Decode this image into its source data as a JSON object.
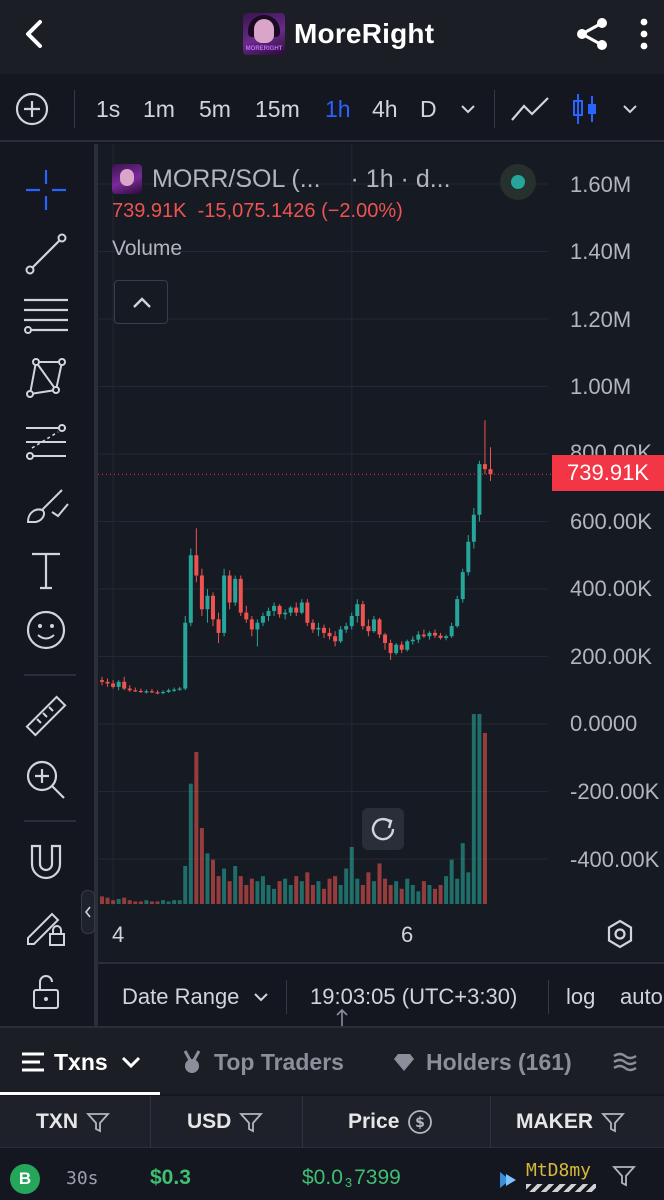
{
  "header": {
    "title": "MoreRight",
    "logo_text": "MORERIGHT"
  },
  "toolbar": {
    "intervals": [
      "1s",
      "1m",
      "5m",
      "15m",
      "1h",
      "4h",
      "D"
    ],
    "active_interval": "1h"
  },
  "legend": {
    "pair": "MORR/SOL (...",
    "timeframe": "· 1h · d...",
    "value": "739.91K",
    "change": "-15,075.1426 (−2.00%)",
    "volume_label": "Volume"
  },
  "price_axis": {
    "labels": [
      "1.60M",
      "1.40M",
      "1.20M",
      "1.00M",
      "800.00K",
      "600.00K",
      "400.00K",
      "200.00K",
      "0.0000",
      "-200.00K",
      "-400.00K"
    ],
    "last_price": "739.91K"
  },
  "time_axis": {
    "labels": [
      "4",
      "6"
    ]
  },
  "footer": {
    "date_range": "Date Range",
    "time": "19:03:05 (UTC+3:30)",
    "log": "log",
    "auto": "auto"
  },
  "tabs": {
    "txns": "Txns",
    "top_traders": "Top Traders",
    "holders": "Holders (161)"
  },
  "table": {
    "headers": [
      "TXN",
      "USD",
      "Price",
      "MAKER"
    ],
    "rows": [
      {
        "type": "B",
        "age": "30s",
        "usd": "$0.3",
        "price_prefix": "$0.0",
        "price_zeros": "3",
        "price_digits": "7399",
        "maker": "MtD8my"
      }
    ]
  },
  "colors": {
    "up": "#26a69a",
    "down": "#ef5350",
    "accent": "#2962ff",
    "last_price_tag": "#f23645"
  },
  "chart_data": {
    "type": "candlestick",
    "title": "",
    "ylim": [
      -450000,
      1700000
    ],
    "candles": [
      {
        "o": 130000,
        "h": 140000,
        "l": 115000,
        "c": 125000
      },
      {
        "o": 125000,
        "h": 135000,
        "l": 110000,
        "c": 120000
      },
      {
        "o": 120000,
        "h": 130000,
        "l": 105000,
        "c": 110000
      },
      {
        "o": 110000,
        "h": 130000,
        "l": 100000,
        "c": 125000
      },
      {
        "o": 125000,
        "h": 140000,
        "l": 100000,
        "c": 105000
      },
      {
        "o": 105000,
        "h": 115000,
        "l": 95000,
        "c": 100000
      },
      {
        "o": 100000,
        "h": 108000,
        "l": 95000,
        "c": 98000
      },
      {
        "o": 98000,
        "h": 105000,
        "l": 92000,
        "c": 95000
      },
      {
        "o": 95000,
        "h": 102000,
        "l": 90000,
        "c": 97000
      },
      {
        "o": 97000,
        "h": 104000,
        "l": 92000,
        "c": 94000
      },
      {
        "o": 94000,
        "h": 100000,
        "l": 88000,
        "c": 92000
      },
      {
        "o": 92000,
        "h": 100000,
        "l": 88000,
        "c": 95000
      },
      {
        "o": 95000,
        "h": 105000,
        "l": 92000,
        "c": 100000
      },
      {
        "o": 100000,
        "h": 108000,
        "l": 95000,
        "c": 102000
      },
      {
        "o": 102000,
        "h": 110000,
        "l": 98000,
        "c": 105000
      },
      {
        "o": 105000,
        "h": 320000,
        "l": 100000,
        "c": 300000
      },
      {
        "o": 300000,
        "h": 520000,
        "l": 290000,
        "c": 500000
      },
      {
        "o": 500000,
        "h": 580000,
        "l": 420000,
        "c": 440000
      },
      {
        "o": 440000,
        "h": 460000,
        "l": 320000,
        "c": 340000
      },
      {
        "o": 340000,
        "h": 400000,
        "l": 300000,
        "c": 380000
      },
      {
        "o": 380000,
        "h": 390000,
        "l": 290000,
        "c": 310000
      },
      {
        "o": 310000,
        "h": 330000,
        "l": 240000,
        "c": 270000
      },
      {
        "o": 270000,
        "h": 460000,
        "l": 260000,
        "c": 440000
      },
      {
        "o": 440000,
        "h": 455000,
        "l": 340000,
        "c": 360000
      },
      {
        "o": 360000,
        "h": 440000,
        "l": 350000,
        "c": 430000
      },
      {
        "o": 430000,
        "h": 440000,
        "l": 320000,
        "c": 330000
      },
      {
        "o": 330000,
        "h": 350000,
        "l": 300000,
        "c": 310000
      },
      {
        "o": 310000,
        "h": 320000,
        "l": 260000,
        "c": 280000
      },
      {
        "o": 280000,
        "h": 310000,
        "l": 230000,
        "c": 300000
      },
      {
        "o": 300000,
        "h": 330000,
        "l": 290000,
        "c": 320000
      },
      {
        "o": 320000,
        "h": 345000,
        "l": 305000,
        "c": 335000
      },
      {
        "o": 335000,
        "h": 360000,
        "l": 320000,
        "c": 350000
      },
      {
        "o": 350000,
        "h": 355000,
        "l": 315000,
        "c": 325000
      },
      {
        "o": 325000,
        "h": 340000,
        "l": 310000,
        "c": 330000
      },
      {
        "o": 330000,
        "h": 350000,
        "l": 320000,
        "c": 345000
      },
      {
        "o": 345000,
        "h": 360000,
        "l": 320000,
        "c": 330000
      },
      {
        "o": 330000,
        "h": 370000,
        "l": 325000,
        "c": 360000
      },
      {
        "o": 360000,
        "h": 370000,
        "l": 290000,
        "c": 300000
      },
      {
        "o": 300000,
        "h": 310000,
        "l": 270000,
        "c": 280000
      },
      {
        "o": 280000,
        "h": 300000,
        "l": 260000,
        "c": 285000
      },
      {
        "o": 285000,
        "h": 295000,
        "l": 255000,
        "c": 270000
      },
      {
        "o": 270000,
        "h": 285000,
        "l": 250000,
        "c": 260000
      },
      {
        "o": 260000,
        "h": 275000,
        "l": 230000,
        "c": 245000
      },
      {
        "o": 245000,
        "h": 290000,
        "l": 240000,
        "c": 280000
      },
      {
        "o": 280000,
        "h": 300000,
        "l": 270000,
        "c": 290000
      },
      {
        "o": 290000,
        "h": 330000,
        "l": 280000,
        "c": 320000
      },
      {
        "o": 320000,
        "h": 370000,
        "l": 300000,
        "c": 355000
      },
      {
        "o": 355000,
        "h": 365000,
        "l": 280000,
        "c": 290000
      },
      {
        "o": 290000,
        "h": 310000,
        "l": 260000,
        "c": 275000
      },
      {
        "o": 275000,
        "h": 320000,
        "l": 270000,
        "c": 310000
      },
      {
        "o": 310000,
        "h": 315000,
        "l": 255000,
        "c": 265000
      },
      {
        "o": 265000,
        "h": 270000,
        "l": 220000,
        "c": 240000
      },
      {
        "o": 240000,
        "h": 250000,
        "l": 190000,
        "c": 210000
      },
      {
        "o": 210000,
        "h": 240000,
        "l": 205000,
        "c": 235000
      },
      {
        "o": 235000,
        "h": 245000,
        "l": 210000,
        "c": 220000
      },
      {
        "o": 220000,
        "h": 250000,
        "l": 215000,
        "c": 245000
      },
      {
        "o": 245000,
        "h": 260000,
        "l": 235000,
        "c": 250000
      },
      {
        "o": 250000,
        "h": 275000,
        "l": 240000,
        "c": 265000
      },
      {
        "o": 265000,
        "h": 280000,
        "l": 255000,
        "c": 260000
      },
      {
        "o": 260000,
        "h": 275000,
        "l": 250000,
        "c": 270000
      },
      {
        "o": 270000,
        "h": 280000,
        "l": 255000,
        "c": 262000
      },
      {
        "o": 262000,
        "h": 270000,
        "l": 250000,
        "c": 255000
      },
      {
        "o": 255000,
        "h": 265000,
        "l": 248000,
        "c": 260000
      },
      {
        "o": 260000,
        "h": 300000,
        "l": 255000,
        "c": 290000
      },
      {
        "o": 290000,
        "h": 380000,
        "l": 285000,
        "c": 370000
      },
      {
        "o": 370000,
        "h": 460000,
        "l": 360000,
        "c": 450000
      },
      {
        "o": 450000,
        "h": 560000,
        "l": 440000,
        "c": 540000
      },
      {
        "o": 540000,
        "h": 640000,
        "l": 520000,
        "c": 620000
      },
      {
        "o": 620000,
        "h": 780000,
        "l": 600000,
        "c": 770000
      },
      {
        "o": 770000,
        "h": 900000,
        "l": 740000,
        "c": 755000
      },
      {
        "o": 755000,
        "h": 820000,
        "l": 720000,
        "c": 739910
      }
    ],
    "volume": [
      6,
      5,
      3,
      4,
      5,
      3,
      2,
      2,
      3,
      2,
      2,
      3,
      2,
      3,
      3,
      30,
      95,
      120,
      60,
      40,
      35,
      22,
      28,
      18,
      30,
      22,
      15,
      20,
      18,
      22,
      15,
      12,
      18,
      20,
      15,
      22,
      18,
      25,
      15,
      18,
      12,
      20,
      22,
      15,
      28,
      45,
      20,
      15,
      25,
      18,
      32,
      20,
      15,
      18,
      12,
      20,
      15,
      10,
      18,
      15,
      12,
      15,
      22,
      35,
      20,
      48,
      25,
      150,
      150,
      135
    ],
    "last_price": 739910,
    "time_ticks": [
      {
        "label": "4",
        "index": 2
      },
      {
        "label": "6",
        "index": 45
      }
    ]
  }
}
